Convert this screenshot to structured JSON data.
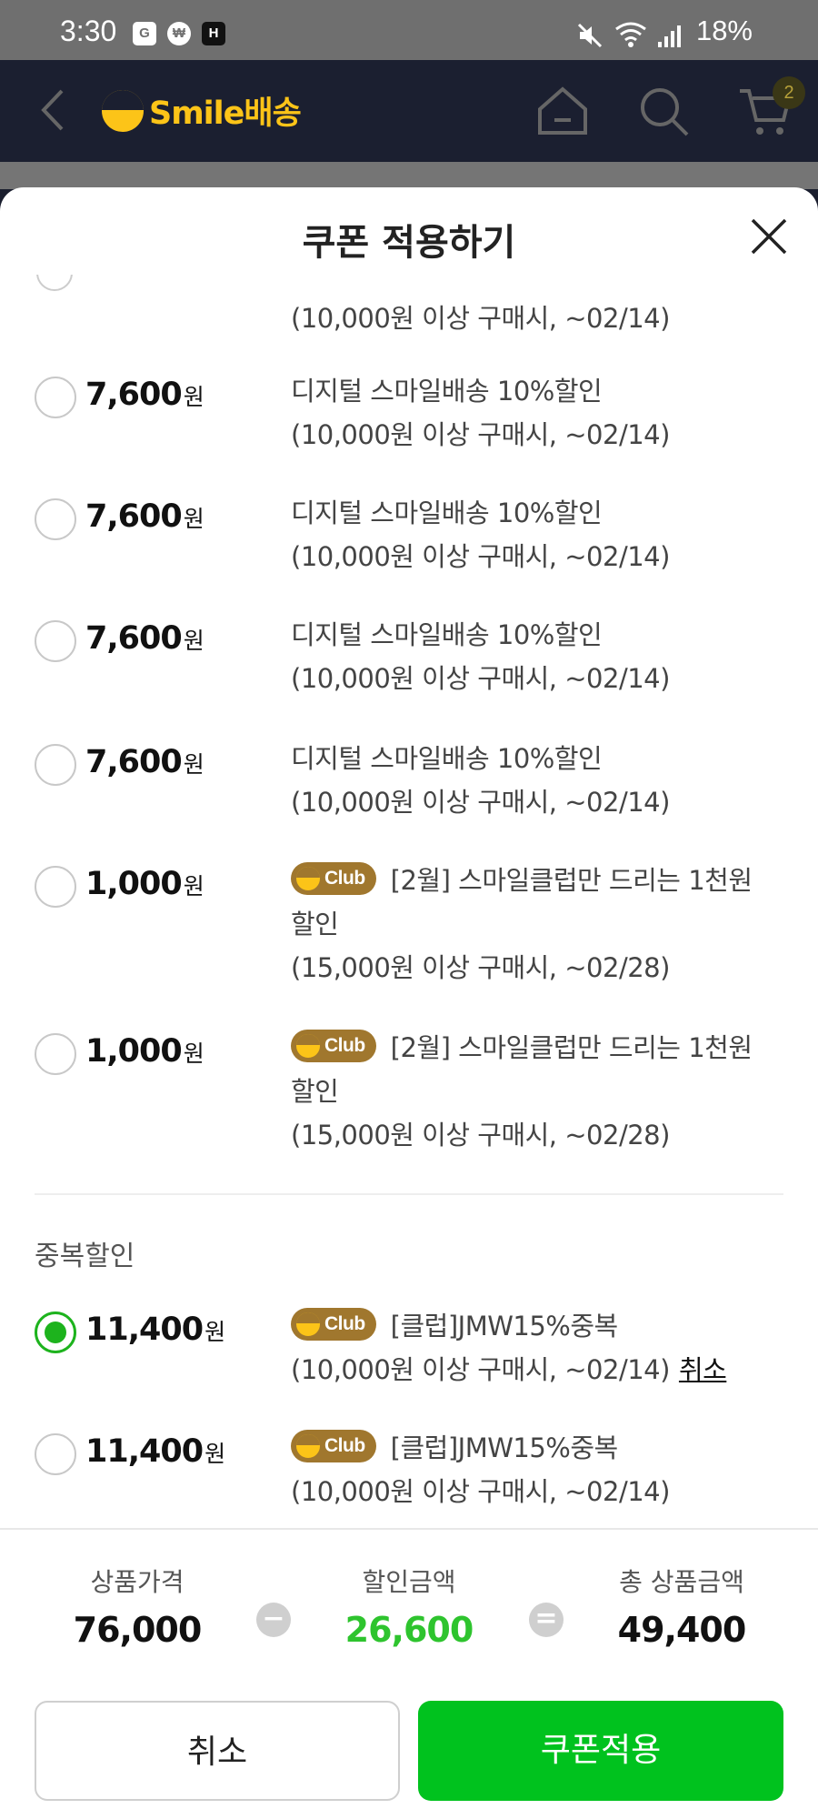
{
  "status_bar": {
    "time": "3:30",
    "icons": [
      "G",
      "₩",
      "H"
    ],
    "battery": "18%"
  },
  "app_bar": {
    "logo": "Smile배송",
    "cart_count": "2"
  },
  "sheet": {
    "title": "쿠폰 적용하기"
  },
  "partial_row": {
    "condition": "(10,000원 이상 구매시, ~02/14)"
  },
  "coupons": [
    {
      "amount": "7,600",
      "unit": "원",
      "club": false,
      "name": "디지털 스마일배송 10%할인",
      "condition": "(10,000원 이상 구매시, ~02/14)",
      "selected": false
    },
    {
      "amount": "7,600",
      "unit": "원",
      "club": false,
      "name": "디지털 스마일배송 10%할인",
      "condition": "(10,000원 이상 구매시, ~02/14)",
      "selected": false
    },
    {
      "amount": "7,600",
      "unit": "원",
      "club": false,
      "name": "디지털 스마일배송 10%할인",
      "condition": "(10,000원 이상 구매시, ~02/14)",
      "selected": false
    },
    {
      "amount": "7,600",
      "unit": "원",
      "club": false,
      "name": "디지털 스마일배송 10%할인",
      "condition": "(10,000원 이상 구매시, ~02/14)",
      "selected": false
    },
    {
      "amount": "1,000",
      "unit": "원",
      "club": true,
      "club_label": "Club",
      "name": "[2월] 스마일클럽만 드리는 1천원 할인",
      "condition": "(15,000원 이상 구매시, ~02/28)",
      "selected": false
    },
    {
      "amount": "1,000",
      "unit": "원",
      "club": true,
      "club_label": "Club",
      "name": "[2월] 스마일클럽만 드리는 1천원 할인",
      "condition": "(15,000원 이상 구매시, ~02/28)",
      "selected": false
    }
  ],
  "duplicate_section": {
    "label": "중복할인",
    "coupons": [
      {
        "amount": "11,400",
        "unit": "원",
        "club": true,
        "club_label": "Club",
        "name": "[클럽]JMW15%중복",
        "condition": "(10,000원 이상 구매시, ~02/14)",
        "cancel_label": "취소",
        "selected": true
      },
      {
        "amount": "11,400",
        "unit": "원",
        "club": true,
        "club_label": "Club",
        "name": "[클럽]JMW15%중복",
        "condition": "(10,000원 이상 구매시, ~02/14)",
        "selected": false
      }
    ]
  },
  "summary": {
    "product_price_label": "상품가격",
    "product_price": "76,000",
    "discount_label": "할인금액",
    "discount": "26,600",
    "total_label": "총 상품금액",
    "total": "49,400",
    "minus_symbol": "−",
    "equals_symbol": "="
  },
  "buttons": {
    "cancel": "취소",
    "apply": "쿠폰적용"
  },
  "colors": {
    "accent_green": "#00c21e",
    "discount_green": "#2ec42e",
    "club_badge": "#a0772e",
    "brand_yellow": "#fcc418"
  }
}
